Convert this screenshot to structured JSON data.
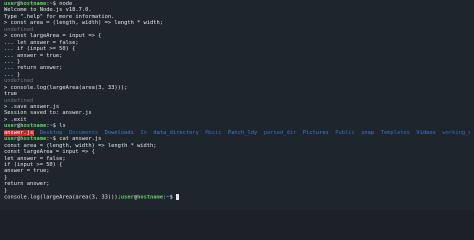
{
  "prompt": {
    "user": "user",
    "at": "@",
    "host": "hostname",
    "sep": ":",
    "path": "~",
    "dollar": "$"
  },
  "lines": [
    {
      "type": "cmd",
      "text": "node"
    },
    {
      "type": "out",
      "text": "Welcome to Node.js v18.7.0."
    },
    {
      "type": "out",
      "text": "Type \".help\" for more information."
    },
    {
      "type": "out",
      "text": "> const area = (length, width) => length * width;"
    },
    {
      "type": "muted",
      "text": "undefined"
    },
    {
      "type": "out",
      "text": "> const largeArea = input => {"
    },
    {
      "type": "out",
      "text": "... let answer = false;"
    },
    {
      "type": "out",
      "text": "... if (input >= 50) {"
    },
    {
      "type": "out",
      "text": "... answer = true;"
    },
    {
      "type": "out",
      "text": "... }"
    },
    {
      "type": "out",
      "text": "... return answer;"
    },
    {
      "type": "out",
      "text": "... }"
    },
    {
      "type": "muted",
      "text": "undefined"
    },
    {
      "type": "out",
      "text": "> console.log(largeArea(area(3, 33)));"
    },
    {
      "type": "out",
      "text": "true"
    },
    {
      "type": "muted",
      "text": "undefined"
    },
    {
      "type": "out",
      "text": "> .save answer.js"
    },
    {
      "type": "out",
      "text": "Session saved to: answer.js"
    },
    {
      "type": "out",
      "text": "> .exit"
    },
    {
      "type": "cmd",
      "text": "ls"
    },
    {
      "type": "ls"
    },
    {
      "type": "cmd",
      "text": "cat answer.js"
    },
    {
      "type": "out",
      "text": "const area = (length, width) => length * width;"
    },
    {
      "type": "out",
      "text": "const largeArea = input => {"
    },
    {
      "type": "out",
      "text": "let answer = false;"
    },
    {
      "type": "out",
      "text": "if (input >= 50) {"
    },
    {
      "type": "out",
      "text": "answer = true;"
    },
    {
      "type": "out",
      "text": "}"
    },
    {
      "type": "out",
      "text": "return answer;"
    },
    {
      "type": "out",
      "text": "}"
    },
    {
      "type": "last",
      "text": "console.log(largeArea(area(3, 33)));"
    }
  ],
  "ls": {
    "highlighted": "answer.js",
    "dirs": [
      "Desktop",
      "Documents",
      "Downloads",
      "In",
      "data_directory",
      "Music",
      "Patch_ldy",
      "parsed_dir",
      "Pictures",
      "Public",
      "snap",
      "Templates",
      "Videos",
      "working_directory"
    ]
  },
  "colors": {
    "background": "#1f252c",
    "prompt_green": "#5fd35f",
    "path_blue": "#5aa0ff",
    "dir_blue": "#3b7fd6",
    "highlight_red": "#c62828"
  }
}
